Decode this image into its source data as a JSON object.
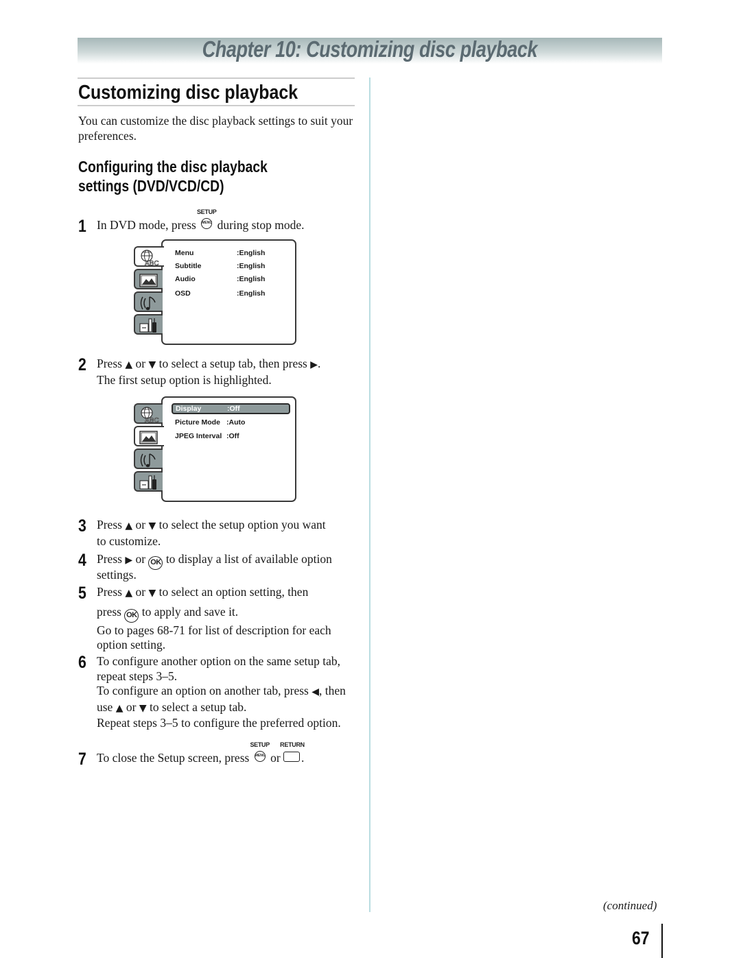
{
  "chapter_header": "Chapter 10: Customizing disc playback",
  "section_title": "Customizing disc playback",
  "intro": "You can customize the disc playback settings to suit your preferences.",
  "subsection_title_line1": "Configuring the disc playback",
  "subsection_title_line2": "settings (DVD/VCD/CD)",
  "buttons": {
    "setup_label": "SETUP",
    "setup_face": "MENU",
    "return_label": "RETURN",
    "ok_face": "OK"
  },
  "glyphs": {
    "up": "▲",
    "down": "▼",
    "right": "▶",
    "left": "◀"
  },
  "steps": [
    {
      "num": "1",
      "pre": "In DVD mode, press",
      "post": "during stop mode."
    },
    {
      "num": "2",
      "a": "Press",
      "b": "or",
      "c": "to select a setup tab, then press",
      "d": ".",
      "line2": "The first setup option is highlighted."
    },
    {
      "num": "3",
      "a": "Press",
      "b": "or",
      "c": "to select the setup option you want",
      "line2": "to customize."
    },
    {
      "num": "4",
      "a": "Press",
      "b": "or",
      "c": "to display a list of available option",
      "line2": "settings."
    },
    {
      "num": "5",
      "a": "Press",
      "b": "or",
      "c": "to select an option setting, then",
      "d": "press",
      "e": "to apply and save it.",
      "para2": "Go to pages 68-71 for list of description for each option setting."
    },
    {
      "num": "6",
      "line1": "To configure another option on the same setup tab, repeat steps 3–5.",
      "p2a": "To configure an option on another tab, press",
      "p2b": ",",
      "p2c": "then use",
      "p2d": "or",
      "p2e": "to select a setup tab.",
      "para3": "Repeat steps 3–5 to configure the preferred option."
    },
    {
      "num": "7",
      "pre": "To close the Setup screen, press",
      "mid": "or",
      "post": "."
    }
  ],
  "osd_language": {
    "active_tab": "language",
    "rows": [
      {
        "label": "Menu",
        "value": ":English"
      },
      {
        "label": "Subtitle",
        "value": ":English"
      },
      {
        "label": "Audio",
        "value": ":English"
      },
      {
        "label": "OSD",
        "value": ":English"
      }
    ]
  },
  "osd_display": {
    "active_tab": "display",
    "highlighted_row": 0,
    "rows": [
      {
        "label": "Display",
        "value": ":Off"
      },
      {
        "label": "Picture Mode",
        "value": ":Auto"
      },
      {
        "label": "JPEG Interval",
        "value": ":Off"
      }
    ]
  },
  "osd_tabs": [
    {
      "name": "language",
      "icon": "globe-abc-icon"
    },
    {
      "name": "display",
      "icon": "picture-icon"
    },
    {
      "name": "audio",
      "icon": "music-note-icon"
    },
    {
      "name": "other",
      "icon": "tools-icon"
    }
  ],
  "continued": "(continued)",
  "page_number": "67",
  "colors": {
    "header_text": "#5b6a71",
    "header_gradient_top": "#a6b7b8",
    "divider": "#b9dde1",
    "osd_highlight": "#8e9a9b"
  }
}
